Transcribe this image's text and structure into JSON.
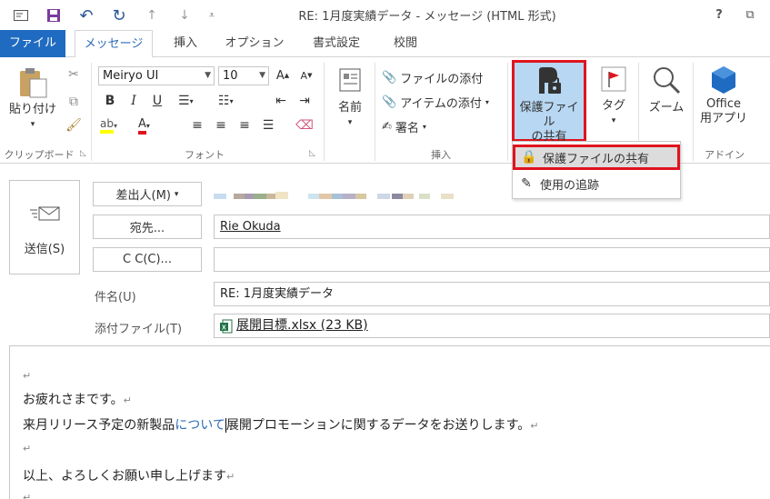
{
  "window": {
    "title": "RE: 1月度実績データ - メッセージ (HTML 形式)",
    "help": "?",
    "restore": "⧉"
  },
  "qat": {
    "icons": [
      "mail-icon",
      "save-icon",
      "undo-icon",
      "redo-icon",
      "up-icon",
      "down-icon",
      "customize-icon"
    ]
  },
  "tabs": [
    {
      "label": "ファイル"
    },
    {
      "label": "メッセージ"
    },
    {
      "label": "挿入"
    },
    {
      "label": "オプション"
    },
    {
      "label": "書式設定"
    },
    {
      "label": "校閲"
    }
  ],
  "ribbon": {
    "clipboard": {
      "paste": "貼り付け",
      "group": "クリップボード"
    },
    "font": {
      "font_name": "Meiryo UI",
      "font_size": "10",
      "bold": "B",
      "italic": "I",
      "underline": "U",
      "group": "フォント"
    },
    "names": {
      "label": "名前"
    },
    "insert": {
      "attach_file": "ファイルの添付",
      "attach_item": "アイテムの添付",
      "signature": "署名",
      "group": "挿入"
    },
    "protect": {
      "label_line1": "保護ファイル",
      "label_line2": "の共有"
    },
    "tags": {
      "label": "タグ"
    },
    "zoom": {
      "label": "ズーム"
    },
    "addins": {
      "label_line1": "Office",
      "label_line2": "用アプリ",
      "group": "アドイン"
    }
  },
  "protect_menu": {
    "items": [
      {
        "label": "保護ファイルの共有"
      },
      {
        "label": "使用の追跡"
      }
    ]
  },
  "header": {
    "send": "送信(S)",
    "from_button": "差出人(M)",
    "to_button": "宛先...",
    "to_value": "Rie Okuda",
    "cc_button": "C C(C)...",
    "cc_value": "",
    "subject_label": "件名(U)",
    "subject_value": "RE: 1月度実績データ",
    "attach_label": "添付ファイル(T)",
    "attachment": "展開目標.xlsx (23 KB)"
  },
  "body": {
    "line1": "お疲れさまです。",
    "line2_a": "来月リリース予定の新製品",
    "line2_link": "について",
    "line2_b": "展開プロモーションに関するデータをお送りします。",
    "line3": "以上、よろしくお願い申し上げます"
  }
}
